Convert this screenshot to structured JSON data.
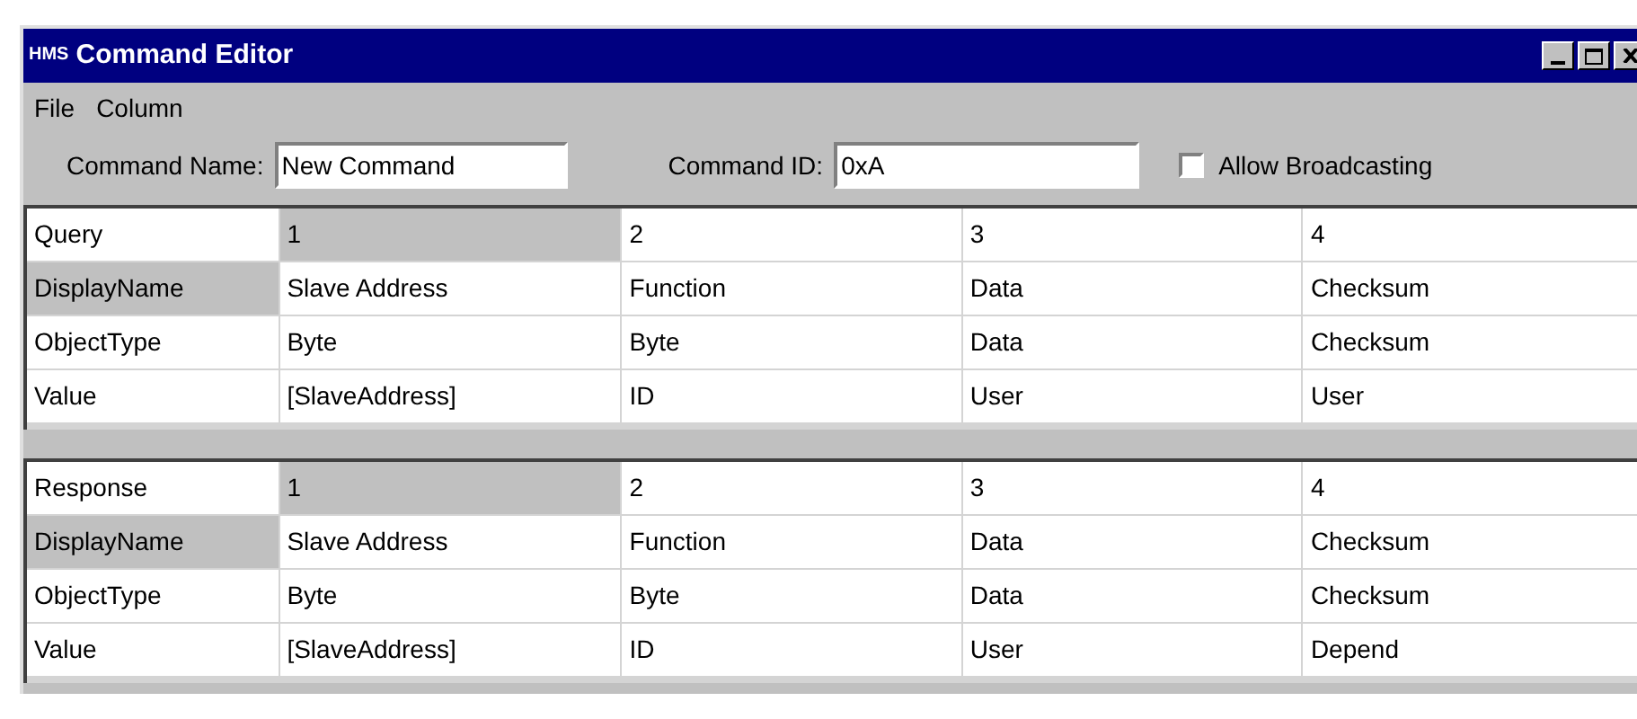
{
  "window": {
    "title": "Command Editor",
    "logo": "HMS"
  },
  "menu": [
    {
      "label": "File"
    },
    {
      "label": "Column"
    }
  ],
  "command_name": {
    "label": "Command Name:",
    "value": "New Command"
  },
  "command_id": {
    "label": "Command ID:",
    "value": "0xA"
  },
  "allow_broadcasting": {
    "label": "Allow Broadcasting",
    "checked": false
  },
  "grids": [
    {
      "title": "Query",
      "columns": [
        {
          "label": "1",
          "selected": true
        },
        {
          "label": "2",
          "selected": false
        },
        {
          "label": "3",
          "selected": false
        },
        {
          "label": "4",
          "selected": false
        }
      ],
      "rows": [
        {
          "label": "DisplayName",
          "selected": true,
          "cells": [
            "Slave Address",
            "Function",
            "Data",
            "Checksum"
          ]
        },
        {
          "label": "ObjectType",
          "selected": false,
          "cells": [
            "Byte",
            "Byte",
            "Data",
            "Checksum"
          ]
        },
        {
          "label": "Value",
          "selected": false,
          "cells": [
            "[SlaveAddress]",
            "ID",
            "User",
            "User"
          ]
        }
      ]
    },
    {
      "title": "Response",
      "columns": [
        {
          "label": "1",
          "selected": true
        },
        {
          "label": "2",
          "selected": false
        },
        {
          "label": "3",
          "selected": false
        },
        {
          "label": "4",
          "selected": false
        }
      ],
      "rows": [
        {
          "label": "DisplayName",
          "selected": true,
          "cells": [
            "Slave Address",
            "Function",
            "Data",
            "Checksum"
          ]
        },
        {
          "label": "ObjectType",
          "selected": false,
          "cells": [
            "Byte",
            "Byte",
            "Data",
            "Checksum"
          ]
        },
        {
          "label": "Value",
          "selected": false,
          "cells": [
            "[SlaveAddress]",
            "ID",
            "User",
            "Depend"
          ]
        }
      ]
    }
  ]
}
